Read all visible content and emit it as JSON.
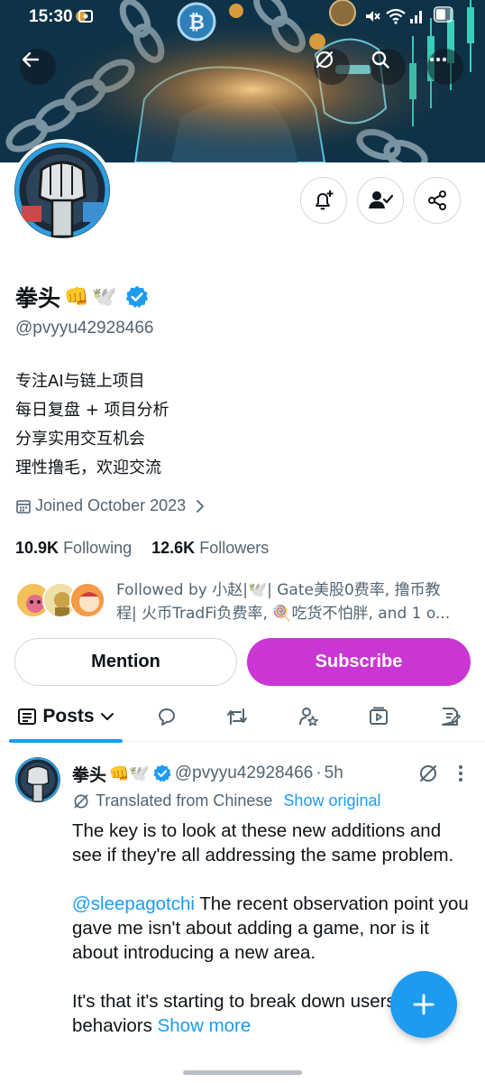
{
  "status_bar": {
    "time": "15:30"
  },
  "profile": {
    "name": "拳头",
    "name_emojis": [
      "👊",
      "🕊️"
    ],
    "verified": true,
    "handle": "@pvyyu42928466",
    "bio_lines": [
      "专注AI与链上项目",
      "每日复盘 + 项目分析",
      "分享实用交互机会",
      "理性撸毛，欢迎交流"
    ],
    "joined": "Joined October 2023",
    "following_count": "10.9K",
    "following_label": "Following",
    "followers_count": "12.6K",
    "followers_label": "Followers",
    "followed_by_line1": "Followed by 小赵|🕊️| Gate美股0费率, 撸币教",
    "followed_by_line2": "程| 火币TradFi负费率, 🍭吃货不怕胖, and 1 o..."
  },
  "buttons": {
    "mention": "Mention",
    "subscribe": "Subscribe"
  },
  "tabs": {
    "posts": "Posts"
  },
  "post": {
    "name": "拳头",
    "name_emojis": "👊🕊️",
    "handle": "@pvyyu42928466",
    "separator": "·",
    "time": "5h",
    "translated_label": "Translated from Chinese",
    "show_original": "Show original",
    "para1": "The key is to look at these new additions and see if they're all addressing the same problem.",
    "mention": "@sleepagotchi",
    "para2": " The recent observation point you gave me isn't about adding a game, nor is it about introducing a new area.",
    "para3": "It's that it's starting to break down users' daily behaviors",
    "show_more": "Show more"
  },
  "colors": {
    "accent": "#1d9bf0",
    "subscribe": "#c936d4",
    "secondary_text": "#536471",
    "text": "#0f1419"
  },
  "icons": [
    "back-arrow-icon",
    "grok-icon",
    "search-icon",
    "more-horizontal-icon",
    "bell-plus-icon",
    "person-check-icon",
    "share-icon",
    "calendar-icon",
    "chevron-right-icon",
    "verified-badge-icon",
    "chevron-down-icon",
    "reply-icon",
    "retweet-icon",
    "person-star-icon",
    "video-icon",
    "article-icon",
    "compose-plus-icon"
  ]
}
